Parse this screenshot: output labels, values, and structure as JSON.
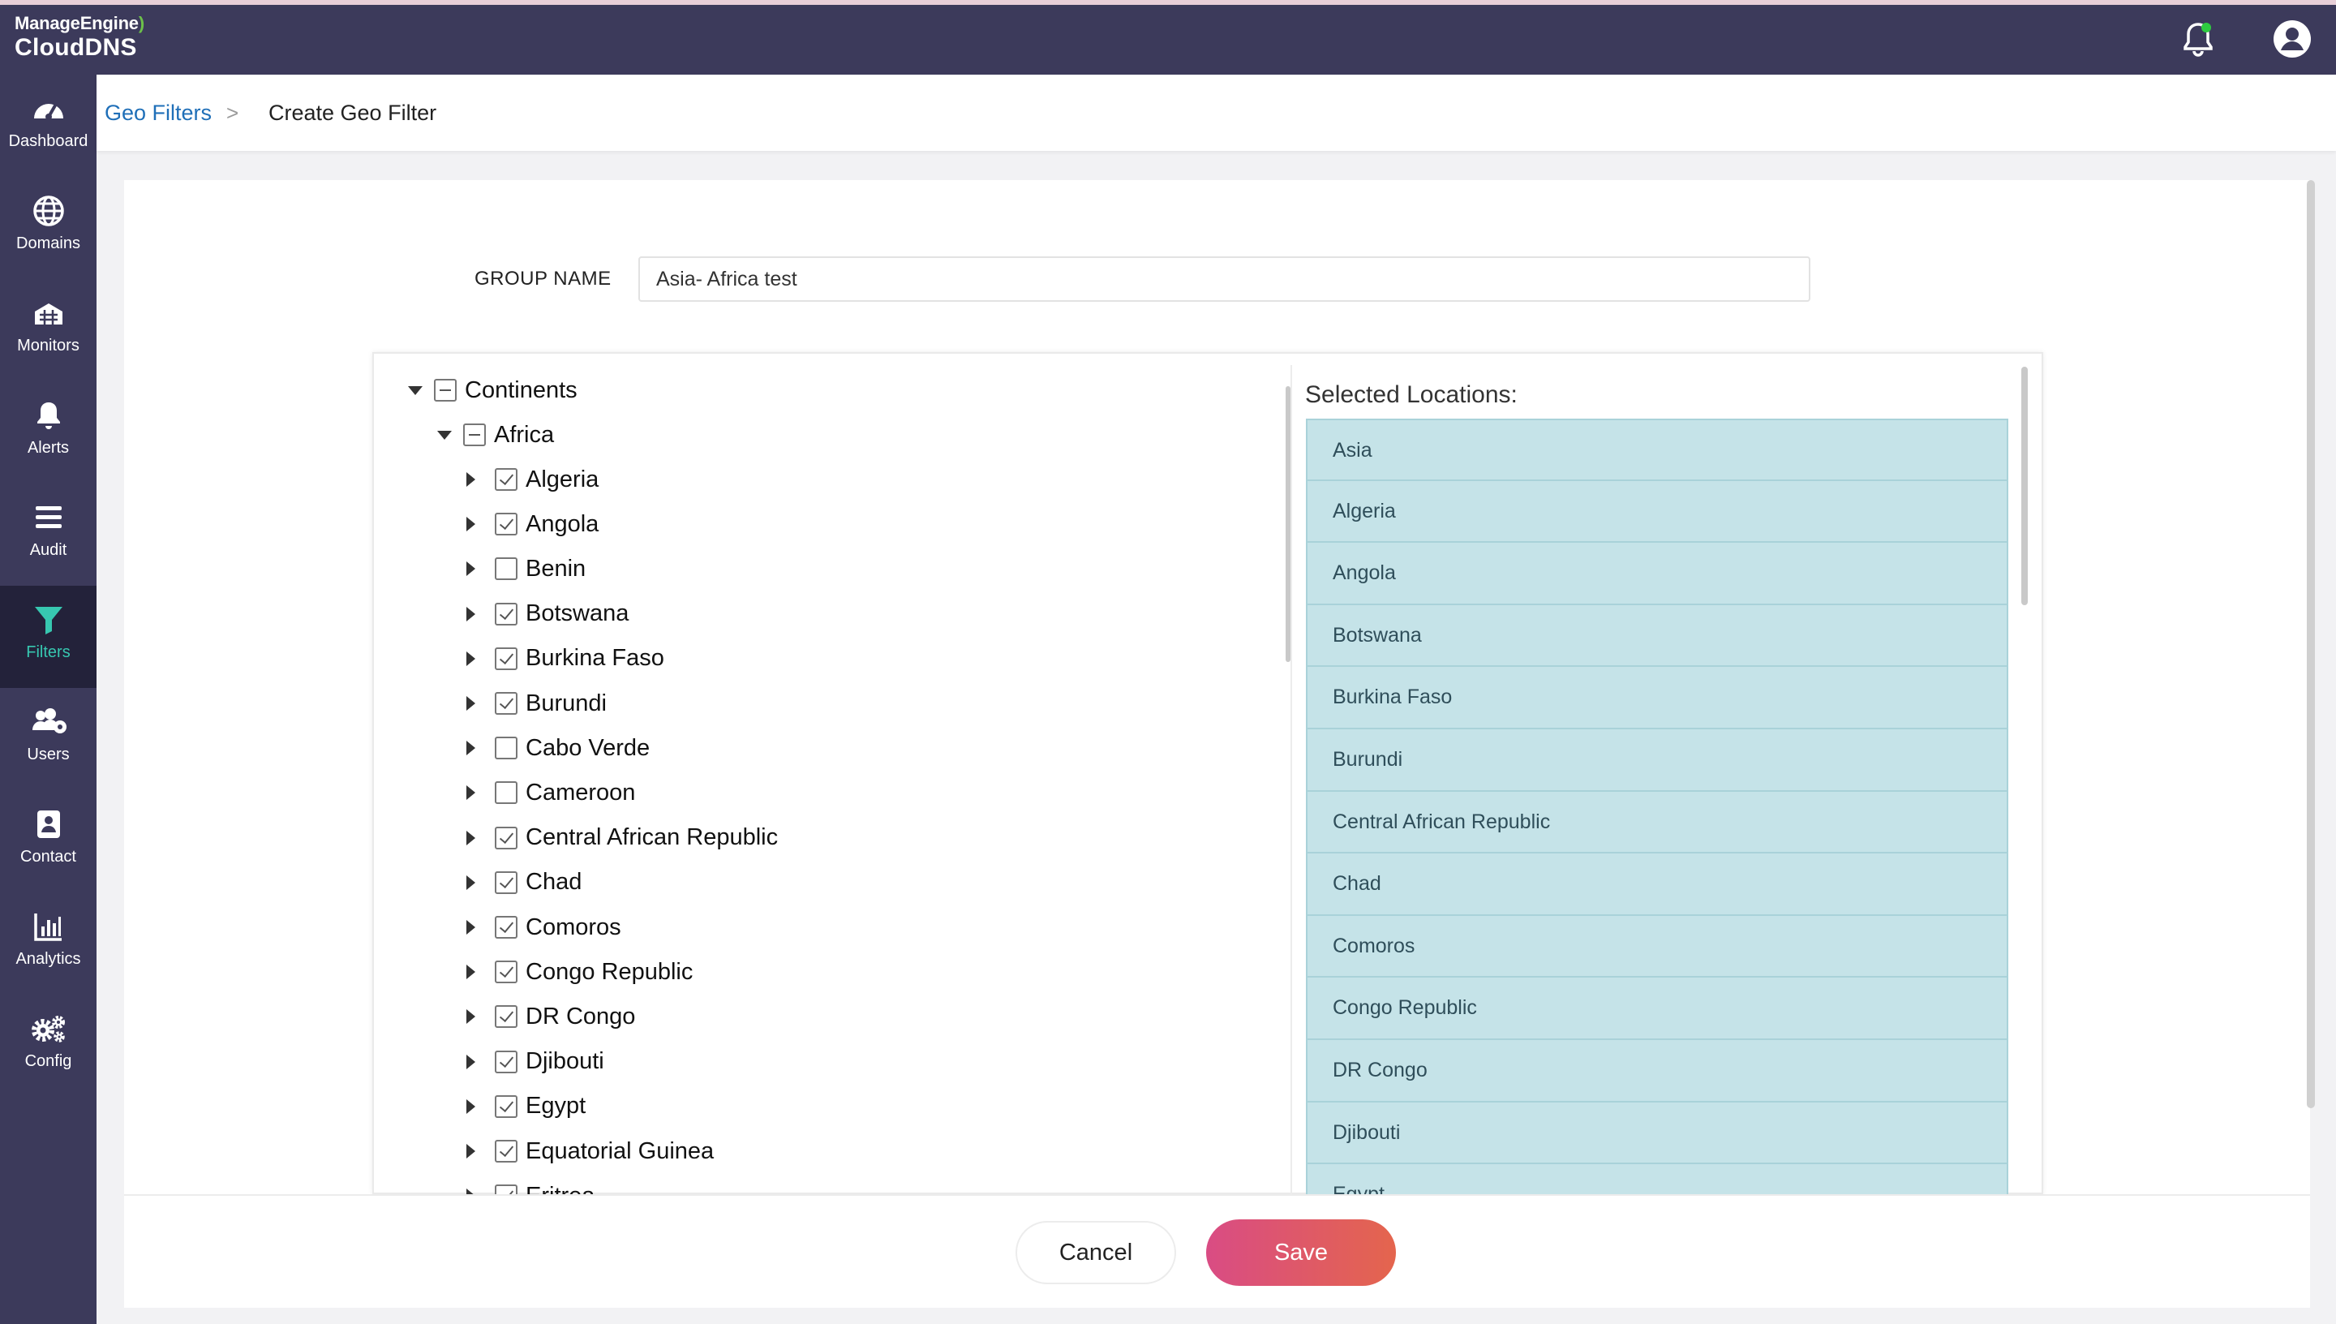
{
  "app": {
    "brand": "ManageEngine",
    "product": "CloudDNS"
  },
  "colors": {
    "header": "#3c3a5b",
    "accent": "#37c7b0",
    "save": "#d94c84"
  },
  "sidebar": {
    "items": [
      {
        "label": "Dashboard",
        "icon": "dashboard-icon"
      },
      {
        "label": "Domains",
        "icon": "globe-icon"
      },
      {
        "label": "Monitors",
        "icon": "monitor-icon"
      },
      {
        "label": "Alerts",
        "icon": "bell-icon"
      },
      {
        "label": "Audit",
        "icon": "list-icon"
      },
      {
        "label": "Filters",
        "icon": "filter-icon",
        "active": true
      },
      {
        "label": "Users",
        "icon": "users-icon"
      },
      {
        "label": "Contact",
        "icon": "contact-icon"
      },
      {
        "label": "Analytics",
        "icon": "chart-icon"
      },
      {
        "label": "Config",
        "icon": "gear-icon"
      }
    ]
  },
  "breadcrumb": {
    "parent": "Geo Filters",
    "separator": ">",
    "current": "Create Geo Filter"
  },
  "form": {
    "group_name_label": "GROUP NAME",
    "group_name_value": "Asia- Africa test"
  },
  "tree": {
    "root": {
      "label": "Continents",
      "state": "partial"
    },
    "continent": {
      "label": "Africa",
      "state": "partial"
    },
    "countries": [
      {
        "label": "Algeria",
        "checked": true
      },
      {
        "label": "Angola",
        "checked": true
      },
      {
        "label": "Benin",
        "checked": false
      },
      {
        "label": "Botswana",
        "checked": true
      },
      {
        "label": "Burkina Faso",
        "checked": true
      },
      {
        "label": "Burundi",
        "checked": true
      },
      {
        "label": "Cabo Verde",
        "checked": false
      },
      {
        "label": "Cameroon",
        "checked": false
      },
      {
        "label": "Central African Republic",
        "checked": true
      },
      {
        "label": "Chad",
        "checked": true
      },
      {
        "label": "Comoros",
        "checked": true
      },
      {
        "label": "Congo Republic",
        "checked": true
      },
      {
        "label": "DR Congo",
        "checked": true
      },
      {
        "label": "Djibouti",
        "checked": true
      },
      {
        "label": "Egypt",
        "checked": true
      },
      {
        "label": "Equatorial Guinea",
        "checked": true
      },
      {
        "label": "Eritrea",
        "checked": true
      }
    ]
  },
  "selected": {
    "title": "Selected Locations:",
    "items": [
      "Asia",
      "Algeria",
      "Angola",
      "Botswana",
      "Burkina Faso",
      "Burundi",
      "Central African Republic",
      "Chad",
      "Comoros",
      "Congo Republic",
      "DR Congo",
      "Djibouti",
      "Egypt"
    ]
  },
  "buttons": {
    "cancel": "Cancel",
    "save": "Save"
  }
}
